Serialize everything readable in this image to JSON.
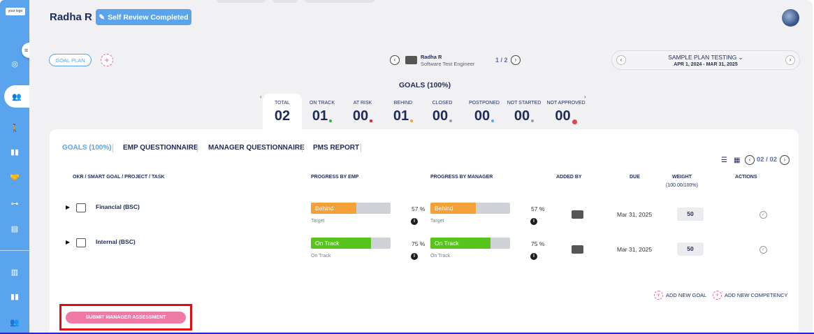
{
  "sidebar": {
    "logo_text": "your logo",
    "icons": [
      "target-icon",
      "team-icon",
      "person-icon",
      "book-icon",
      "handshake-icon",
      "org-chart-icon",
      "report-icon",
      "chart-icon",
      "book-icon",
      "users-icon"
    ]
  },
  "header": {
    "user_name": "Radha R",
    "status_label": "Self Review Completed"
  },
  "goal_plan_label": "GOAL PLAN",
  "employee": {
    "name": "Radha R",
    "role": "Software Test Engineer",
    "pager": "1 / 2"
  },
  "plan": {
    "title": "SAMPLE PLAN TESTING",
    "dates": "APR 1, 2024 - MAR 31, 2025"
  },
  "goals_heading": "GOALS (100%)",
  "stats": [
    {
      "label": "TOTAL",
      "value": "02",
      "dot_color": ""
    },
    {
      "label": "ON TRACK",
      "value": "01",
      "dot_color": "#2fb34a"
    },
    {
      "label": "AT RISK",
      "value": "00",
      "dot_color": "#e01f1f"
    },
    {
      "label": "BEHIND",
      "value": "01",
      "dot_color": "#f5a13a"
    },
    {
      "label": "CLOSED",
      "value": "00",
      "dot_color": "#9a9aa0"
    },
    {
      "label": "POSTPONED",
      "value": "00",
      "dot_color": "#5aa4ee"
    },
    {
      "label": "NOT STARTED",
      "value": "00",
      "dot_color": "#9a9aa0"
    },
    {
      "label": "NOT APPROVED",
      "value": "00",
      "dot_color": "#e0434f"
    }
  ],
  "tabs": [
    "GOALS (100%)",
    "EMP QUESTIONNAIRE",
    "MANAGER QUESTIONNAIRE",
    "PMS REPORT"
  ],
  "card_pager": "02 / 02",
  "columns": {
    "goal": "OKR / SMART GOAL / PROJECT / TASK",
    "prog_emp": "PROGRESS BY EMP",
    "prog_mgr": "PROGRESS BY MANAGER",
    "added_by": "ADDED BY",
    "due": "DUE",
    "weight": "WEIGHT",
    "weight_sub": "(100.00/100%)",
    "actions": "ACTIONS"
  },
  "rows": [
    {
      "title": "Financial (BSC)",
      "emp_status": "Behind",
      "emp_fill": 0.57,
      "emp_color": "#f5a13a",
      "emp_sub": "Target",
      "emp_pct": "57 %",
      "mgr_status": "Behind",
      "mgr_fill": 0.57,
      "mgr_color": "#f5a13a",
      "mgr_sub": "Target",
      "mgr_pct": "57 %",
      "due": "Mar 31, 2025",
      "weight": "50"
    },
    {
      "title": "Internal (BSC)",
      "emp_status": "On Track",
      "emp_fill": 0.75,
      "emp_color": "#57c51b",
      "emp_sub": "On Track",
      "emp_pct": "75 %",
      "mgr_status": "On Track",
      "mgr_fill": 0.75,
      "mgr_color": "#57c51b",
      "mgr_sub": "On Track",
      "mgr_pct": "75 %",
      "due": "Mar 31, 2025",
      "weight": "50"
    }
  ],
  "add_goal": "ADD NEW GOAL",
  "add_competency": "ADD NEW COMPETENCY",
  "submit_label": "SUBMIT MANAGER ASSESSMENT"
}
